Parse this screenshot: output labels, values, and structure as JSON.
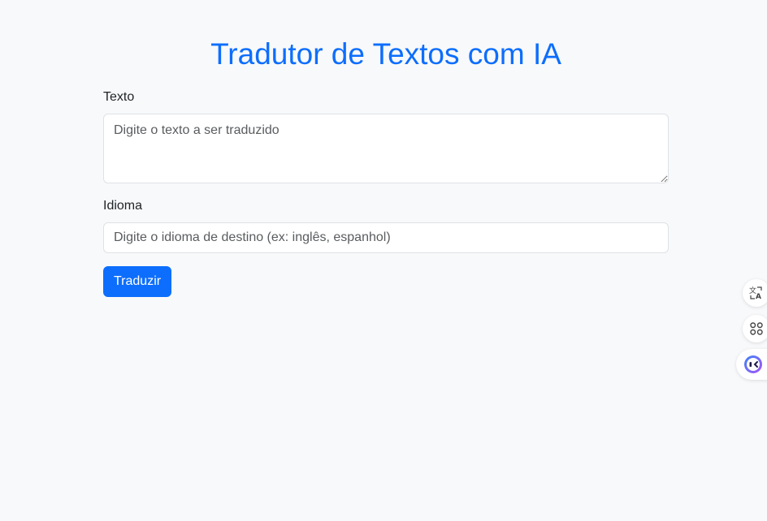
{
  "page": {
    "title": "Tradutor de Textos com IA"
  },
  "form": {
    "text_label": "Texto",
    "text_placeholder": "Digite o texto a ser traduzido",
    "text_value": "",
    "language_label": "Idioma",
    "language_placeholder": "Digite o idioma de destino (ex: inglês, espanhol)",
    "language_value": "",
    "submit_label": "Traduzir"
  },
  "floating_toolbar": {
    "items": [
      {
        "icon": "translate-icon"
      },
      {
        "icon": "apps-grid-icon"
      },
      {
        "icon": "ai-assistant-icon"
      }
    ]
  },
  "colors": {
    "accent": "#0d6efd",
    "background": "#f8f9fa",
    "border": "#dee2e6"
  }
}
